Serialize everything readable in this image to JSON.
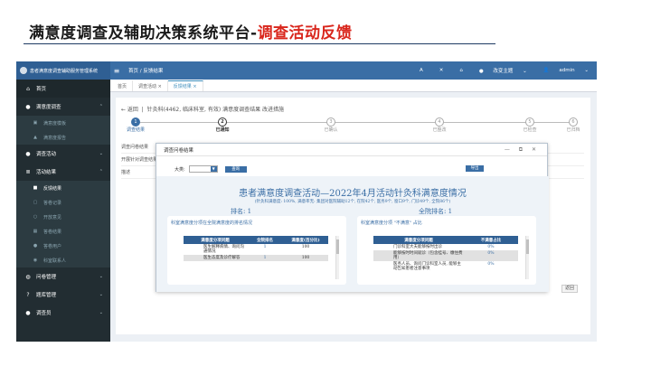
{
  "slide": {
    "title_main": "满意度调查及辅助决策系统平台-",
    "title_accent": "调查活动反馈"
  },
  "topbar": {
    "brand": "患者满意度调查辅助服务管理系统",
    "breadcrumb": "首页 / 反馈结果",
    "icons": [
      "A",
      "✕",
      "⌂"
    ],
    "theme": "改变主题",
    "user": "admin"
  },
  "sidebar": {
    "items": [
      {
        "label": "首页",
        "icon": "home-icon"
      },
      {
        "label": "满意度调查",
        "icon": "user-icon"
      },
      {
        "label": "满意度模板",
        "icon": "clipboard-icon",
        "sub": true
      },
      {
        "label": "满意度报告",
        "icon": "chart-icon",
        "sub": true
      },
      {
        "label": "调查活动",
        "icon": "group-icon"
      },
      {
        "label": "活动结果",
        "icon": "list-icon"
      },
      {
        "label": "反馈结果",
        "icon": "video-icon",
        "sub": true,
        "active": true
      },
      {
        "label": "答卷记录",
        "icon": "doc-icon",
        "sub": true
      },
      {
        "label": "开放意见",
        "icon": "circle-icon",
        "sub": true
      },
      {
        "label": "答卷结果",
        "icon": "table-icon",
        "sub": true
      },
      {
        "label": "答卷用户",
        "icon": "users-icon",
        "sub": true
      },
      {
        "label": "科室联系人",
        "icon": "contact-icon",
        "sub": true
      },
      {
        "label": "问卷管理",
        "icon": "form-icon"
      },
      {
        "label": "题库管理",
        "icon": "question-icon"
      },
      {
        "label": "调查员",
        "icon": "person-icon"
      }
    ]
  },
  "tabs": [
    "首页",
    "调查活动 ×",
    "反馈结果 ×"
  ],
  "content": {
    "back": "← 返回",
    "head": "针灸科(4462, 临床科室, 有效) 满意度调查结果 改进措施",
    "steps": [
      {
        "num": "1",
        "label": "调查结果",
        "state": "done"
      },
      {
        "num": "2",
        "label": "已通知",
        "state": "cur"
      },
      {
        "num": "3",
        "label": "已确认",
        "state": "todo"
      },
      {
        "num": "4",
        "label": "已整改",
        "state": "todo"
      },
      {
        "num": "5",
        "label": "已检查",
        "state": "todo"
      },
      {
        "num": "6",
        "label": "已归档",
        "state": "todo"
      }
    ],
    "rows": [
      "调查问卷结果",
      "开展针对调查结果",
      "描述"
    ],
    "return_btn": "返回"
  },
  "modal": {
    "title": "调查问卷结果",
    "controls": "— ⧉ ✕",
    "type_label": "大类:",
    "search": "查询",
    "export": "导出",
    "report": {
      "title": "患者满意度调查活动—2022年4月活动针灸科满意度情况",
      "subtitle": "(针灸科满意度: 100%, 满意率无: 集团对医院辅助12个, 在院42个, 医务9个, 窗口9个, 门诊49个, 全院86个)",
      "rank_left": "排名: 1",
      "rank_right": "全院排名: 1",
      "left_panel": {
        "title": "科室满意度分项在全院满意度的排名情况",
        "headers": [
          "满意度分项问题",
          "全院排名",
          "满意度(百分比)"
        ],
        "rows": [
          {
            "name": "医生解释病情、询问沟通情况",
            "rank": "1",
            "value": "100"
          },
          {
            "name": "医生态度及诊疗解答",
            "rank": "1",
            "value": "100",
            "alt": true
          }
        ]
      },
      "right_panel": {
        "title": "科室满意度分项 \"不满意\" 占比",
        "headers": [
          "满意度分项问题",
          "不满意占比"
        ],
        "rows": [
          {
            "name": "门诊科室大夫能够按时出诊",
            "value": "0%"
          },
          {
            "name": "能够按时时间就诊（包含挂号、缴住费用）",
            "value": "0%",
            "alt": true
          },
          {
            "name": "医务人员、询问门诊科室人员, 能够主动告知患者注意事项",
            "value": "0%"
          }
        ]
      }
    }
  }
}
